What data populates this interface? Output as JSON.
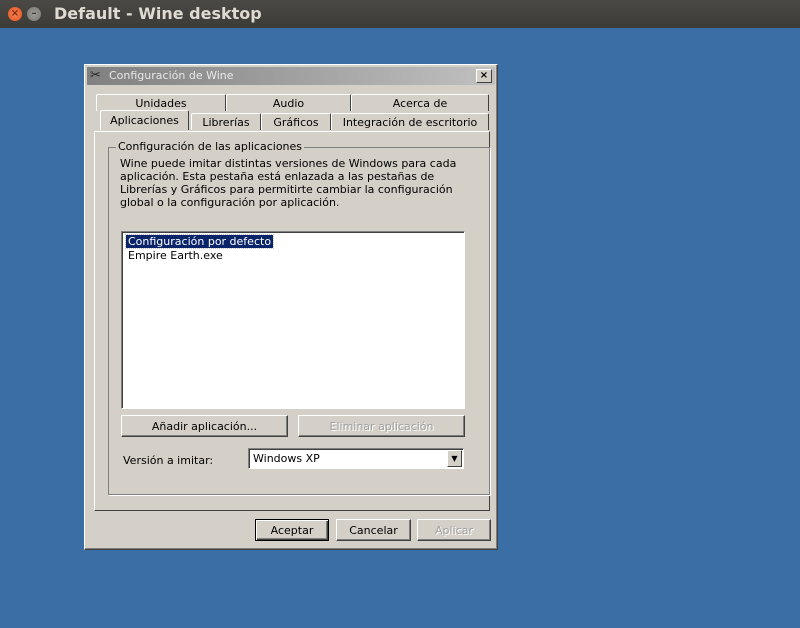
{
  "window": {
    "title": "Default - Wine desktop",
    "close_glyph": "×",
    "minimize_glyph": "–"
  },
  "dialog": {
    "title": "Configuración de Wine",
    "icon": "wine-glass-icon",
    "close_glyph": "×",
    "tabs_back": [
      "Unidades",
      "Audio",
      "Acerca de"
    ],
    "tabs_front": [
      "Aplicaciones",
      "Librerías",
      "Gráficos",
      "Integración de escritorio"
    ],
    "active_tab": "Aplicaciones",
    "group_label": "Configuración de las aplicaciones",
    "description": "Wine puede imitar distintas versiones de Windows para cada aplicación. Esta pestaña está enlazada a las pestañas de Librerías y Gráficos para permitirte cambiar la configuración global o la configuración por aplicación.",
    "applications": [
      {
        "label": "Configuración por defecto",
        "selected": true
      },
      {
        "label": "Empire Earth.exe",
        "selected": false
      }
    ],
    "add_button": "Añadir aplicación...",
    "remove_button": "Eliminar aplicación",
    "version_label": "Versión a imitar:",
    "version_value": "Windows XP",
    "ok_button": "Aceptar",
    "cancel_button": "Cancelar",
    "apply_button": "Aplicar"
  },
  "colors": {
    "desktop": "#3a6ea5",
    "dialog_bg": "#d4d0c8",
    "selection": "#0a246a"
  }
}
